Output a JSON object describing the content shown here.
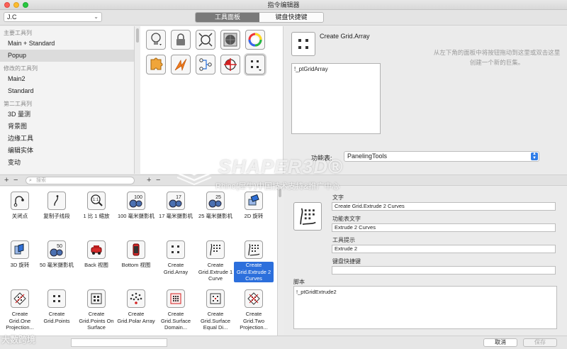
{
  "window": {
    "title": "指令编辑器"
  },
  "file_select": {
    "value": "J.C"
  },
  "tabs": [
    {
      "label": "工具面板",
      "active": true
    },
    {
      "label": "键盘快捷键",
      "active": false
    }
  ],
  "toolbars": {
    "groups": [
      {
        "header": "主要工具列",
        "items": [
          {
            "label": "Main + Standard"
          },
          {
            "label": "Popup",
            "selected": true
          }
        ]
      },
      {
        "header": "修改的工具列",
        "items": [
          {
            "label": "Main2"
          },
          {
            "label": "Standard"
          }
        ]
      },
      {
        "header": "第二工具列",
        "items": [
          {
            "label": "3D 量测"
          },
          {
            "label": "背景图"
          },
          {
            "label": "边缘工具"
          },
          {
            "label": "编辑实体"
          },
          {
            "label": "变动"
          }
        ]
      }
    ]
  },
  "toolbar_icons": [
    "lightbulb-icon",
    "lock-icon",
    "zoom-extents-icon",
    "render-sphere-icon",
    "color-wheel-icon",
    "puzzle-icon",
    "lightning-icon",
    "node-graph-icon",
    "target-icon",
    "grid-array-icon"
  ],
  "selected_button": {
    "title": "Create Grid.Array",
    "macro": "!_ptGridArray"
  },
  "hint": "从左下角的面板中将按钮拖动到这里或双击这里创建一个新的巨集。",
  "function_table": {
    "label": "功能表:",
    "value": "PanelingTools"
  },
  "search": {
    "placeholder": "搜索"
  },
  "commands": [
    {
      "label": "关闭点",
      "icon": "close-point-icon"
    },
    {
      "label": "复制子线段",
      "icon": "copy-subcurve-icon"
    },
    {
      "label": "1 比 1 缩放",
      "icon": "zoom-1to1-icon"
    },
    {
      "label": "100 毫米摄影机",
      "icon": "camera-100-icon",
      "badge": "100"
    },
    {
      "label": "17 毫米摄影机",
      "icon": "camera-17-icon",
      "badge": "17"
    },
    {
      "label": "25 毫米摄影机",
      "icon": "camera-25-icon",
      "badge": "25"
    },
    {
      "label": "2D 旋转",
      "icon": "rotate-2d-icon"
    },
    {
      "label": "3D 旋转",
      "icon": "rotate-3d-icon"
    },
    {
      "label": "50 毫米摄影机",
      "icon": "camera-50-icon",
      "badge": "50"
    },
    {
      "label": "Back 视图",
      "icon": "back-view-icon"
    },
    {
      "label": "Bottom 视图",
      "icon": "bottom-view-icon"
    },
    {
      "label": "Create Grid.Array",
      "icon": "grid-array-icon"
    },
    {
      "label": "Create Grid.Extrude 1 Curve",
      "icon": "grid-extrude-1-icon"
    },
    {
      "label": "Create Grid.Extrude 2 Curves",
      "icon": "grid-extrude-2-icon",
      "selected": true
    },
    {
      "label": "Create Grid.One Projection...",
      "icon": "grid-one-projection-icon"
    },
    {
      "label": "Create Grid.Points",
      "icon": "grid-points-icon"
    },
    {
      "label": "Create Grid.Points On Surface",
      "icon": "grid-points-surface-icon"
    },
    {
      "label": "Create Grid.Polar Array",
      "icon": "grid-polar-icon"
    },
    {
      "label": "Create Grid.Surface Domain...",
      "icon": "grid-surface-domain-icon"
    },
    {
      "label": "Create Grid.Surface Equal Di...",
      "icon": "grid-surface-equal-icon"
    },
    {
      "label": "Create Grid.Two Projection...",
      "icon": "grid-two-projection-icon"
    }
  ],
  "properties": {
    "text_label": "文字",
    "text_value": "Create Grid.Extrude 2 Curves",
    "menu_text_label": "功能表文字",
    "menu_text_value": "Extrude 2 Curves",
    "tooltip_label": "工具提示",
    "tooltip_value": "Extrude 2",
    "shortcut_label": "键盘快捷键",
    "shortcut_value": "",
    "script_label": "脚本",
    "script_value": "!_ptGridExtrude2"
  },
  "footer": {
    "cancel_label": "取消",
    "save_label": "保存"
  },
  "watermark": {
    "brand": "SHAPER3D®",
    "subtitle": "Rhino(犀牛)中国技术支持&推广中心",
    "corner": "大数跨境"
  }
}
